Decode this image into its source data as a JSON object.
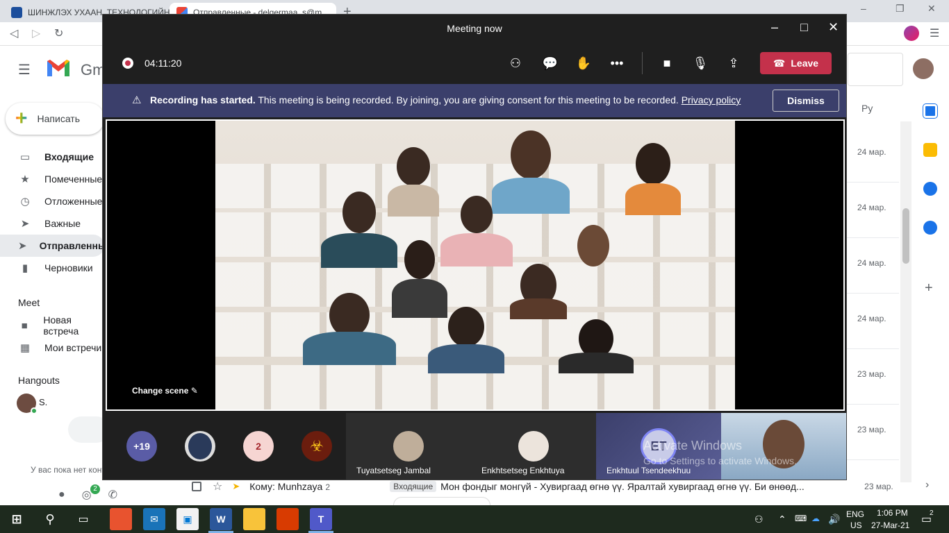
{
  "browser": {
    "tabs": [
      {
        "title": "ШИНЖЛЭХ УХААН, ТЕХНОЛОГИЙН"
      },
      {
        "title": "Отправленные - delgermaa_s@m"
      }
    ],
    "new_tab": "+",
    "min": "–",
    "max": "❐",
    "close": "✕"
  },
  "gmail": {
    "logo_text": "Gm",
    "compose": "Написать",
    "nav": [
      {
        "label": "Входящие",
        "icon": "inbox-icon",
        "glyph": "▭"
      },
      {
        "label": "Помеченные",
        "icon": "star-icon",
        "glyph": "★"
      },
      {
        "label": "Отложенные",
        "icon": "clock-icon",
        "glyph": "◷"
      },
      {
        "label": "Важные",
        "icon": "label-important-icon",
        "glyph": "➤"
      },
      {
        "label": "Отправленные",
        "icon": "send-icon",
        "glyph": "➤"
      },
      {
        "label": "Черновики",
        "icon": "draft-icon",
        "glyph": "▮"
      }
    ],
    "meet_title": "Meet",
    "meet": [
      {
        "label": "Новая встреча",
        "glyph": "■"
      },
      {
        "label": "Мои встречи",
        "glyph": "▦"
      }
    ],
    "hangouts_title": "Hangouts",
    "hangouts_user": "S.",
    "hangouts_empty": "У вас пока нет контактов Hangouts",
    "hangouts_badge": "2",
    "sort": "Ру",
    "dates": [
      "24 мар.",
      "24 мар.",
      "24 мар.",
      "24 мар.",
      "23 мар.",
      "23 мар.",
      "23 мар."
    ],
    "row": {
      "from": "Кому: Munhzaya",
      "count": "2",
      "label": "Входящие",
      "subject": "Мон фондыг монгүй - Хувиргаад өгнө үү. Яралтай хувиргаад өгнө үү. Би өнөөд...",
      "date": "23 мар."
    }
  },
  "teams": {
    "title": "Meeting now",
    "timer": "04:11:20",
    "leave": "Leave",
    "banner_bold": "Recording has started.",
    "banner_text": "This meeting is being recorded. By joining, you are giving consent for this meeting to be recorded.",
    "banner_link": "Privacy policy",
    "dismiss": "Dismiss",
    "change_scene": "Change scene",
    "gallery": {
      "more": "+19",
      "count_badge": "2",
      "names": [
        "Tuyatsetseg Jambal",
        "Enkhtsetseg Enkhtuya",
        "Enkhtuul Tsendeekhuu"
      ],
      "initials": "ET"
    },
    "watermark": "Activate Windows",
    "watermark_sub": "Go to Settings to activate Windows."
  },
  "taskbar": {
    "lang": "ENG",
    "region": "US",
    "time": "1:06 PM",
    "date": "27-Mar-21",
    "notif": "2"
  }
}
